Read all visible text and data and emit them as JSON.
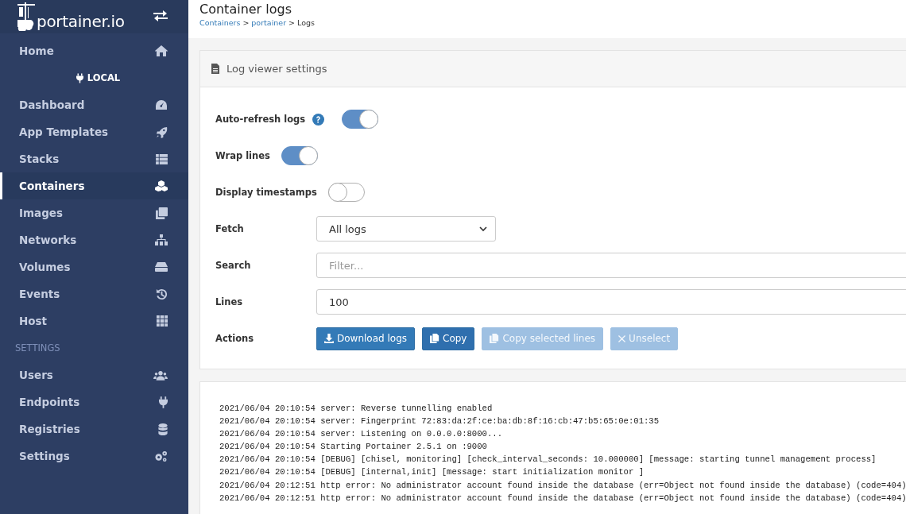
{
  "sidebar": {
    "logo": "portainer.io",
    "home": {
      "label": "Home",
      "selected": false
    },
    "endpoint_heading": "LOCAL",
    "items": [
      {
        "label": "Dashboard",
        "selected": false
      },
      {
        "label": "App Templates",
        "selected": false
      },
      {
        "label": "Stacks",
        "selected": false
      },
      {
        "label": "Containers",
        "selected": true
      },
      {
        "label": "Images",
        "selected": false
      },
      {
        "label": "Networks",
        "selected": false
      },
      {
        "label": "Volumes",
        "selected": false
      },
      {
        "label": "Events",
        "selected": false
      },
      {
        "label": "Host",
        "selected": false
      }
    ],
    "settings_heading": "SETTINGS",
    "settings_items": [
      {
        "label": "Users",
        "selected": false
      },
      {
        "label": "Endpoints",
        "selected": false
      },
      {
        "label": "Registries",
        "selected": false
      },
      {
        "label": "Settings",
        "selected": false
      }
    ]
  },
  "header": {
    "title": "Container logs",
    "breadcrumbs": [
      {
        "label": "Containers",
        "link": true
      },
      {
        "label": "portainer",
        "link": true
      },
      {
        "label": "Logs",
        "link": false
      }
    ],
    "separator": ">"
  },
  "settings": {
    "title": "Log viewer settings",
    "toggles": [
      {
        "label": "Auto-refresh logs",
        "help": true,
        "on": true
      },
      {
        "label": "Wrap lines",
        "help": false,
        "on": true
      },
      {
        "label": "Display timestamps",
        "help": false,
        "on": false
      }
    ],
    "fetch": {
      "label": "Fetch",
      "value": "All logs"
    },
    "search": {
      "label": "Search",
      "placeholder": "Filter..."
    },
    "lines": {
      "label": "Lines",
      "value": "100"
    },
    "actions": {
      "label": "Actions",
      "buttons": [
        {
          "label": "Download logs",
          "kind": "download",
          "disabled": false
        },
        {
          "label": "Copy",
          "kind": "copy",
          "disabled": false
        },
        {
          "label": "Copy selected lines",
          "kind": "copy",
          "disabled": true
        },
        {
          "label": "Unselect",
          "kind": "unselect",
          "disabled": true
        }
      ]
    }
  },
  "logs": [
    "2021/06/04 20:10:54 server: Reverse tunnelling enabled",
    "2021/06/04 20:10:54 server: Fingerprint 72:83:da:2f:ce:ba:db:8f:16:cb:47:b5:65:0e:01:35",
    "2021/06/04 20:10:54 server: Listening on 0.0.0.0:8000...",
    "2021/06/04 20:10:54 Starting Portainer 2.5.1 on :9000",
    "2021/06/04 20:10:54 [DEBUG] [chisel, monitoring] [check_interval_seconds: 10.000000] [message: starting tunnel management process]",
    "2021/06/04 20:10:54 [DEBUG] [internal,init] [message: start initialization monitor ]",
    "2021/06/04 20:12:51 http error: No administrator account found inside the database (err=Object not found inside the database) (code=404)",
    "2021/06/04 20:12:51 http error: No administrator account found inside the database (err=Object not found inside the database) (code=404)"
  ]
}
